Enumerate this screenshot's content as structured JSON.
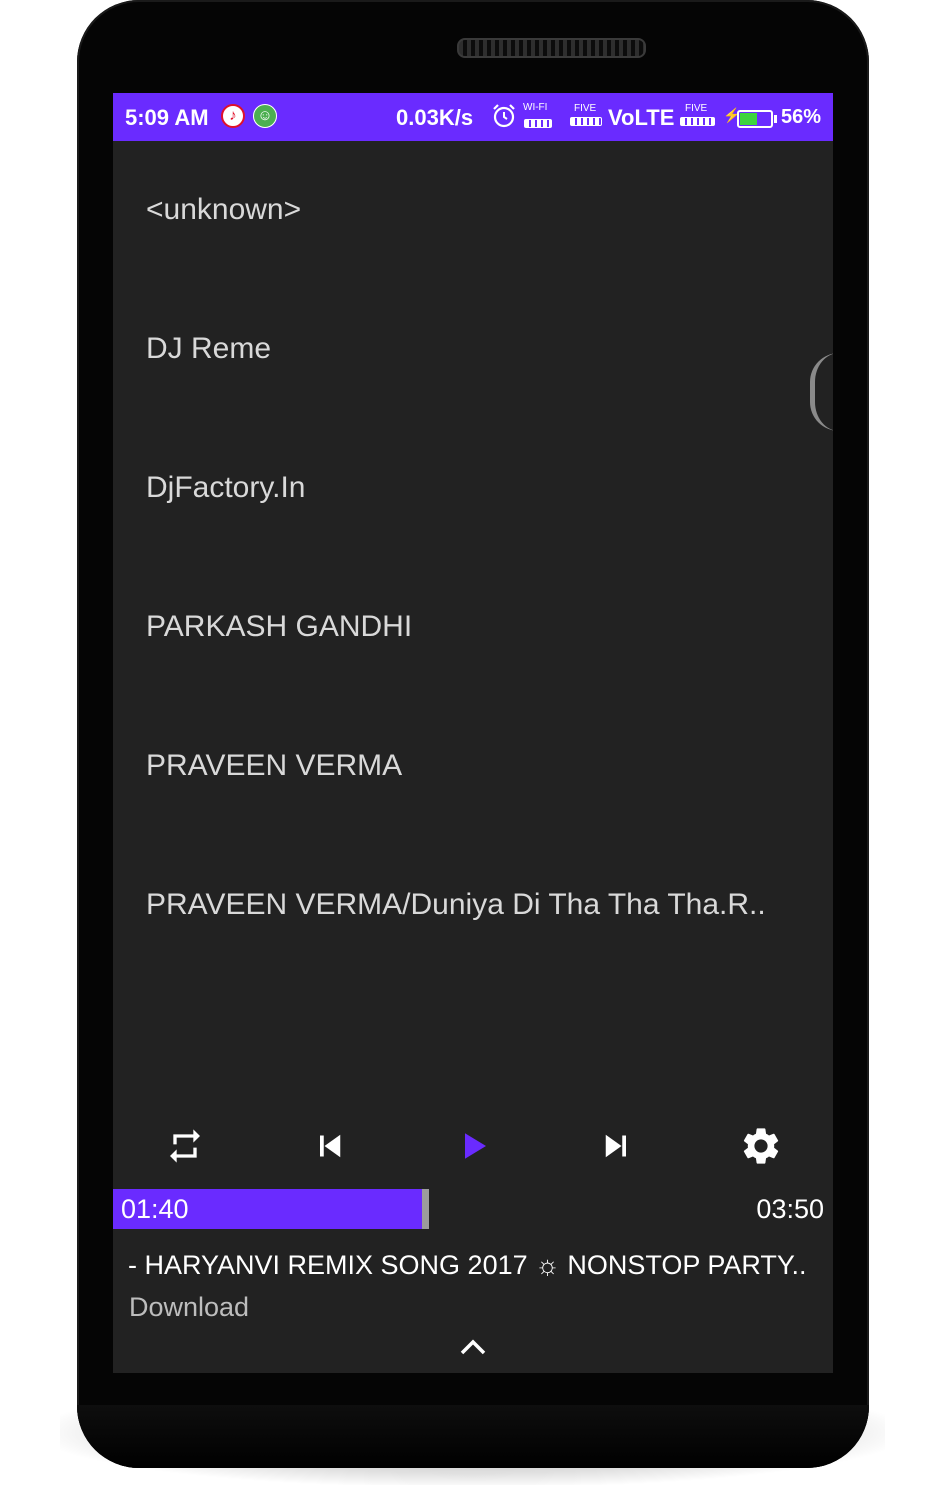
{
  "status_bar": {
    "time": "5:09 AM",
    "net_speed": "0.03K/s",
    "wifi_label": "WI-FI",
    "sim1_label": "FIVE",
    "volte": "VoLTE",
    "sim2_label": "FIVE",
    "battery_percent": "56%",
    "battery_level": 0.56,
    "icons": [
      "music-notification-icon",
      "android-debug-icon",
      "alarm-icon",
      "wifi-icon",
      "signal-icon",
      "charging-icon",
      "battery-icon"
    ],
    "bar_color": "#6a2bff"
  },
  "artists": [
    {
      "label": "<unknown>"
    },
    {
      "label": "DJ Reme"
    },
    {
      "label": "DjFactory.In"
    },
    {
      "label": "PARKASH GANDHI"
    },
    {
      "label": "PRAVEEN VERMA"
    },
    {
      "label": "PRAVEEN VERMA/Duniya Di Tha Tha Tha.R.."
    }
  ],
  "player": {
    "controls": [
      "repeat-icon",
      "previous-icon",
      "play-icon",
      "next-icon",
      "settings-icon"
    ],
    "accent_color": "#6a2bff",
    "current_time": "01:40",
    "total_time": "03:50",
    "progress_fraction": 0.435,
    "song_title": "- HARYANVI REMIX SONG 2017 ☼ NONSTOP PARTY..",
    "song_subtitle": "Download"
  }
}
